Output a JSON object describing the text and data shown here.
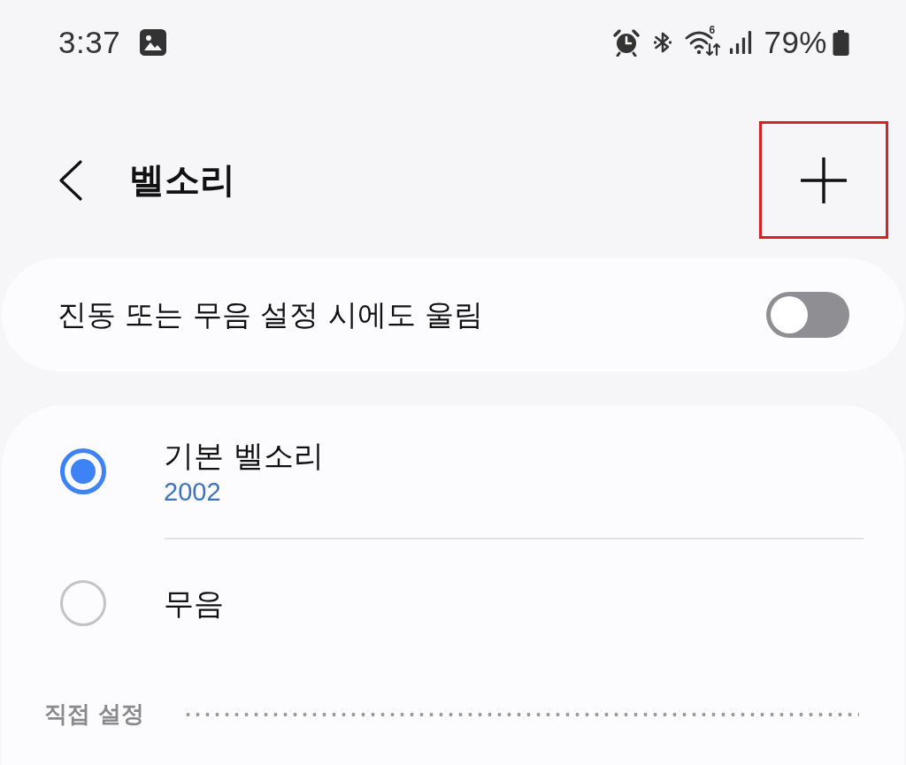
{
  "status_bar": {
    "time": "3:37",
    "wifi_badge": "6",
    "battery": "79%"
  },
  "header": {
    "title": "벨소리",
    "add_button": {
      "highlighted": true
    }
  },
  "toggle_row": {
    "label": "진동 또는 무음 설정 시에도 울림",
    "on": false
  },
  "ringtones": [
    {
      "name": "기본 벨소리",
      "detail": "2002",
      "selected": true
    },
    {
      "name": "무음",
      "selected": false
    }
  ],
  "section": {
    "title": "직접 설정"
  }
}
